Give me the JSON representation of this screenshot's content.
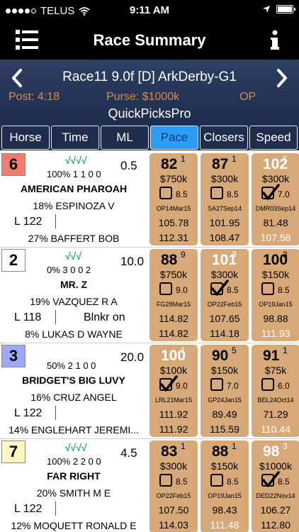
{
  "status": {
    "carrier": "TELUS",
    "time": "9:11 AM"
  },
  "nav": {
    "title": "Race Summary"
  },
  "race": {
    "title": "Race11  9.0f  [D]  ArkDerby-G1",
    "post": "Post: 4:18",
    "purse": "Purse: $1000k",
    "op": "OP",
    "picks": "QuickPicksPro"
  },
  "tabs": [
    {
      "label": "Horse"
    },
    {
      "label": "Time"
    },
    {
      "label": "ML"
    },
    {
      "label": "Pace"
    },
    {
      "label": "Closers"
    },
    {
      "label": "Speed"
    }
  ],
  "colors": {
    "accent": "#2d9cf5",
    "cell": "#d8a978",
    "header": "#1e2d4d",
    "checks": "#2aa866"
  },
  "horses": [
    {
      "num": "6",
      "num_bg": "#f47b6e",
      "checks": "√√√√",
      "ml": "0.5",
      "stats": "100% 1 1 0 0",
      "name": "AMERICAN PHAROAH",
      "jockey": "18% ESPINOZA V",
      "weight": "L 122",
      "equip": "",
      "trainer": "27% BAFFERT BOB",
      "cells": [
        {
          "fig": "82",
          "sup": "1",
          "amt": "$750k",
          "checked": false,
          "bv": "8.5",
          "date": "OP14Mar15",
          "t1": "105.78",
          "t2": "112.31",
          "fig_white": false,
          "t2_white": false
        },
        {
          "fig": "87",
          "sup": "1",
          "amt": "$300k",
          "checked": false,
          "bv": "8.5",
          "date": "SA27Sep14",
          "t1": "101.95",
          "t2": "108.47",
          "fig_white": false,
          "t2_white": false
        },
        {
          "fig": "102",
          "sup": "1",
          "amt": "$300k",
          "checked": true,
          "bv": "7.0",
          "date": "DMR03Sep14",
          "t1": "81.48",
          "t2": "107.58",
          "fig_white": true,
          "t2_white": true
        }
      ]
    },
    {
      "num": "2",
      "num_bg": "#ffffff",
      "checks": "√√√",
      "ml": "10.0",
      "stats": "0% 3 0 0 2",
      "name": "MR. Z",
      "jockey": "19% VAZQUEZ R A",
      "weight": "L 118",
      "equip": "Blnkr on",
      "trainer": "8% LUKAS D WAYNE",
      "cells": [
        {
          "fig": "88",
          "sup": "9",
          "amt": "$750k",
          "checked": false,
          "bv": "9.0",
          "date": "FG28Mar15",
          "t1": "114.82",
          "t2": "114.82",
          "fig_white": false,
          "t2_white": false
        },
        {
          "fig": "101",
          "sup": "3",
          "amt": "$300k",
          "checked": true,
          "bv": "8.5",
          "date": "OP22Feb15",
          "t1": "107.65",
          "t2": "114.18",
          "fig_white": true,
          "t2_white": false
        },
        {
          "fig": "100",
          "sup": "3",
          "amt": "$150k",
          "checked": false,
          "bv": "8.5",
          "date": "OP19Jan15",
          "t1": "98.88",
          "t2": "111.93",
          "fig_white": false,
          "t2_white": true
        }
      ]
    },
    {
      "num": "3",
      "num_bg": "#9fa8f2",
      "checks": "",
      "ml": "20.0",
      "stats": "50% 2 1 0 0",
      "name": "BRIDGET'S BIG LUVY",
      "jockey": "16% CRUZ ANGEL",
      "weight": "L 122",
      "equip": "",
      "trainer": "14% ENGLEHART JEREMI...",
      "cells": [
        {
          "fig": "100",
          "sup": "1",
          "amt": "$100k",
          "checked": true,
          "bv": "9.0",
          "date": "LRL21Mar15",
          "t1": "111.92",
          "t2": "111.92",
          "fig_white": true,
          "t2_white": false
        },
        {
          "fig": "90",
          "sup": "5",
          "amt": "$150k",
          "checked": false,
          "bv": "7.0",
          "date": "GP24Jan15",
          "t1": "89.49",
          "t2": "115.59",
          "fig_white": false,
          "t2_white": false
        },
        {
          "fig": "91",
          "sup": "1",
          "amt": "$75k",
          "checked": false,
          "bv": "6.0",
          "date": "BEL24Oct14",
          "t1": "71.29",
          "t2": "110.44",
          "fig_white": false,
          "t2_white": true
        }
      ]
    },
    {
      "num": "7",
      "num_bg": "#fff7bf",
      "checks": "√√√√",
      "ml": "4.5",
      "stats": "100% 2 2 0 0",
      "name": "FAR RIGHT",
      "jockey": "20% SMITH M E",
      "weight": "L 122",
      "equip": "",
      "trainer": "12% MOQUETT RONALD E",
      "cells": [
        {
          "fig": "83",
          "sup": "1",
          "amt": "$300k",
          "checked": false,
          "bv": "8.5",
          "date": "OP22Feb15",
          "t1": "107.50",
          "t2": "114.03",
          "fig_white": false,
          "t2_white": false
        },
        {
          "fig": "88",
          "sup": "1",
          "amt": "$150k",
          "checked": false,
          "bv": "8.5",
          "date": "OP19Jan15",
          "t1": "98.43",
          "t2": "111.48",
          "fig_white": false,
          "t2_white": true
        },
        {
          "fig": "98",
          "sup": "3",
          "amt": "$1000k",
          "checked": true,
          "bv": "8.5",
          "date": "DED22Nov14",
          "t1": "106.27",
          "t2": "112.80",
          "fig_white": true,
          "t2_white": false
        }
      ]
    }
  ]
}
